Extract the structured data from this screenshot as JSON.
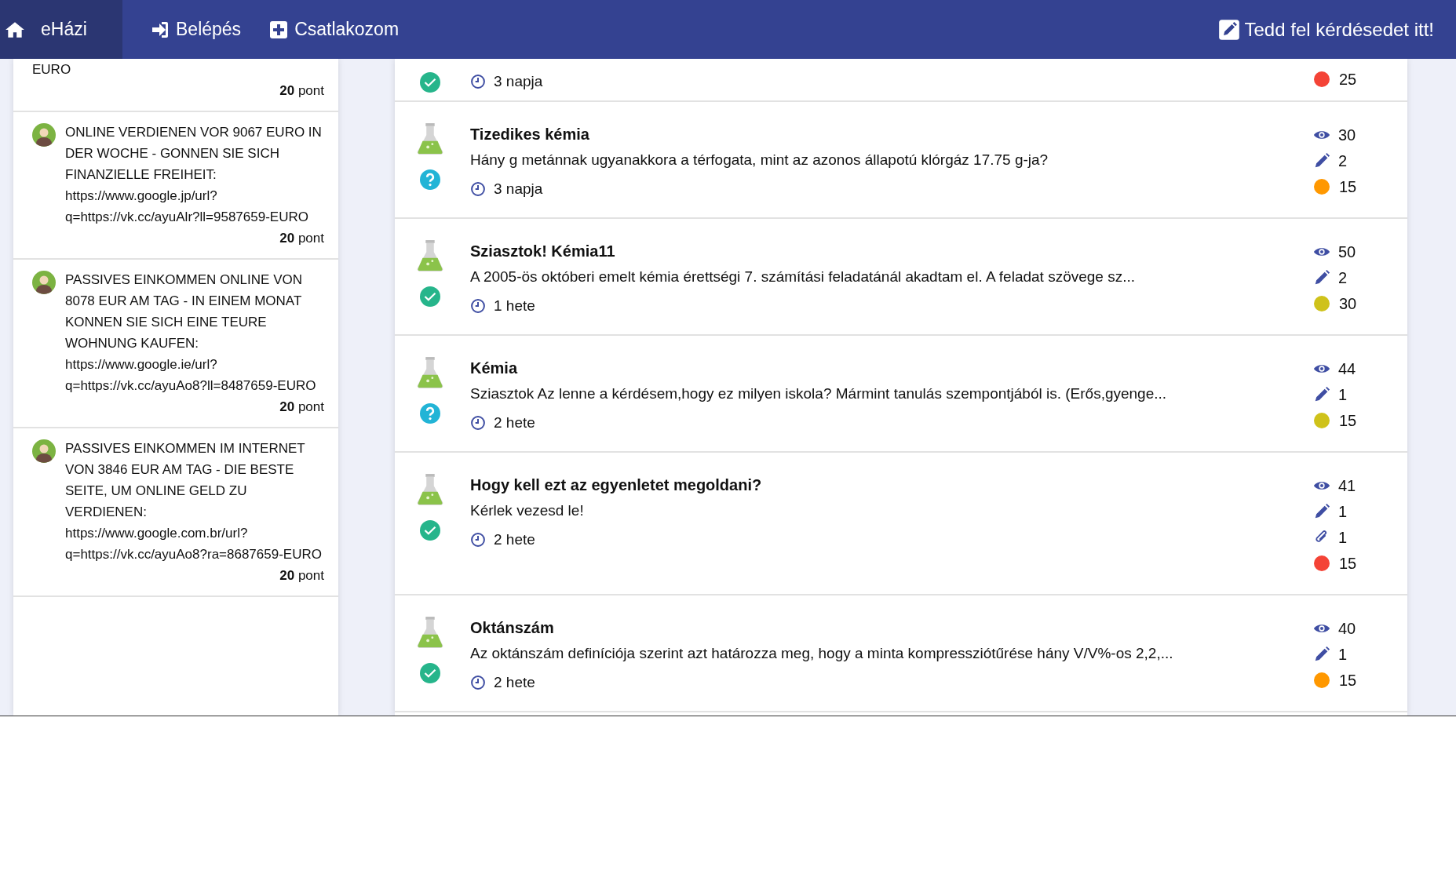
{
  "navbar": {
    "brand": "eHázi",
    "links": [
      {
        "label": "Belépés",
        "kind": "login"
      },
      {
        "label": "Csatlakozom",
        "kind": "join"
      }
    ],
    "ask_button": "Tedd fel kérdésedet itt!"
  },
  "sidebar": {
    "items": [
      {
        "kind": "partial",
        "text": "EURO",
        "points": "**20** pont"
      },
      {
        "kind": "post",
        "text": "ONLINE VERDIENEN VOR 9067 EURO IN DER WOCHE - GONNEN SIE SICH FINANZIELLE FREIHEIT: https://www.google.jp/url?q=https://vk.cc/ayuAlr?ll=9587659-EURO",
        "points": "**20** pont"
      },
      {
        "kind": "post",
        "text": "PASSIVES EINKOMMEN ONLINE VON 8078 EUR AM TAG - IN EINEM MONAT KONNEN SIE SICH EINE TEURE WOHNUNG KAUFEN: https://www.google.ie/url?q=https://vk.cc/ayuAo8?ll=8487659-EURO",
        "points": "**20** pont"
      },
      {
        "kind": "post",
        "text": "PASSIVES EINKOMMEN IM INTERNET VON 3846 EUR AM TAG - DIE BESTE SEITE, UM ONLINE GELD ZU VERDIENEN: https://www.google.com.br/url?q=https://vk.cc/ayuAo8?ra=8687659-EURO",
        "points": "**20** pont"
      }
    ]
  },
  "questions": [
    {
      "kind": "partial",
      "solved": true,
      "time": "3 napja",
      "points": "25",
      "color": "#f44336"
    },
    {
      "kind": "full",
      "title": "Tizedikes kémia",
      "excerpt": "Hány g metánnak ugyanakkora a térfogata, mint az azonos állapotú klórgáz 17.75 g-ja?",
      "solved": false,
      "time": "3 napja",
      "views": "30",
      "answers": "2",
      "points": "15",
      "color": "#ff9800"
    },
    {
      "kind": "full",
      "title": "Sziasztok! Kémia11",
      "excerpt": "A 2005-ös októberi emelt kémia érettségi 7. számítási feladatánál akadtam el. A feladat szövege sz...",
      "solved": true,
      "time": "1 hete",
      "views": "50",
      "answers": "2",
      "points": "30",
      "color": "#cfc21a"
    },
    {
      "kind": "full",
      "title": "Kémia",
      "excerpt": "Sziasztok Az lenne a kérdésem,hogy ez milyen iskola? Mármint tanulás szempontjából is. (Erős,gyenge...",
      "solved": false,
      "time": "2 hete",
      "views": "44",
      "answers": "1",
      "points": "15",
      "color": "#cfc21a"
    },
    {
      "kind": "full",
      "title": "Hogy kell ezt az egyenletet megoldani?",
      "excerpt": "Kérlek vezesd le!",
      "solved": true,
      "time": "2 hete",
      "views": "41",
      "answers": "1",
      "attachments": "1",
      "points": "15",
      "color": "#f44336"
    },
    {
      "kind": "full",
      "title": "Oktánszám",
      "excerpt": "Az oktánszám definíciója szerint azt határozza meg, hogy a minta kompressziótűrése hány V/V%-os 2,2,...",
      "solved": true,
      "time": "2 hete",
      "views": "40",
      "answers": "1",
      "points": "15",
      "color": "#ff9800"
    }
  ]
}
